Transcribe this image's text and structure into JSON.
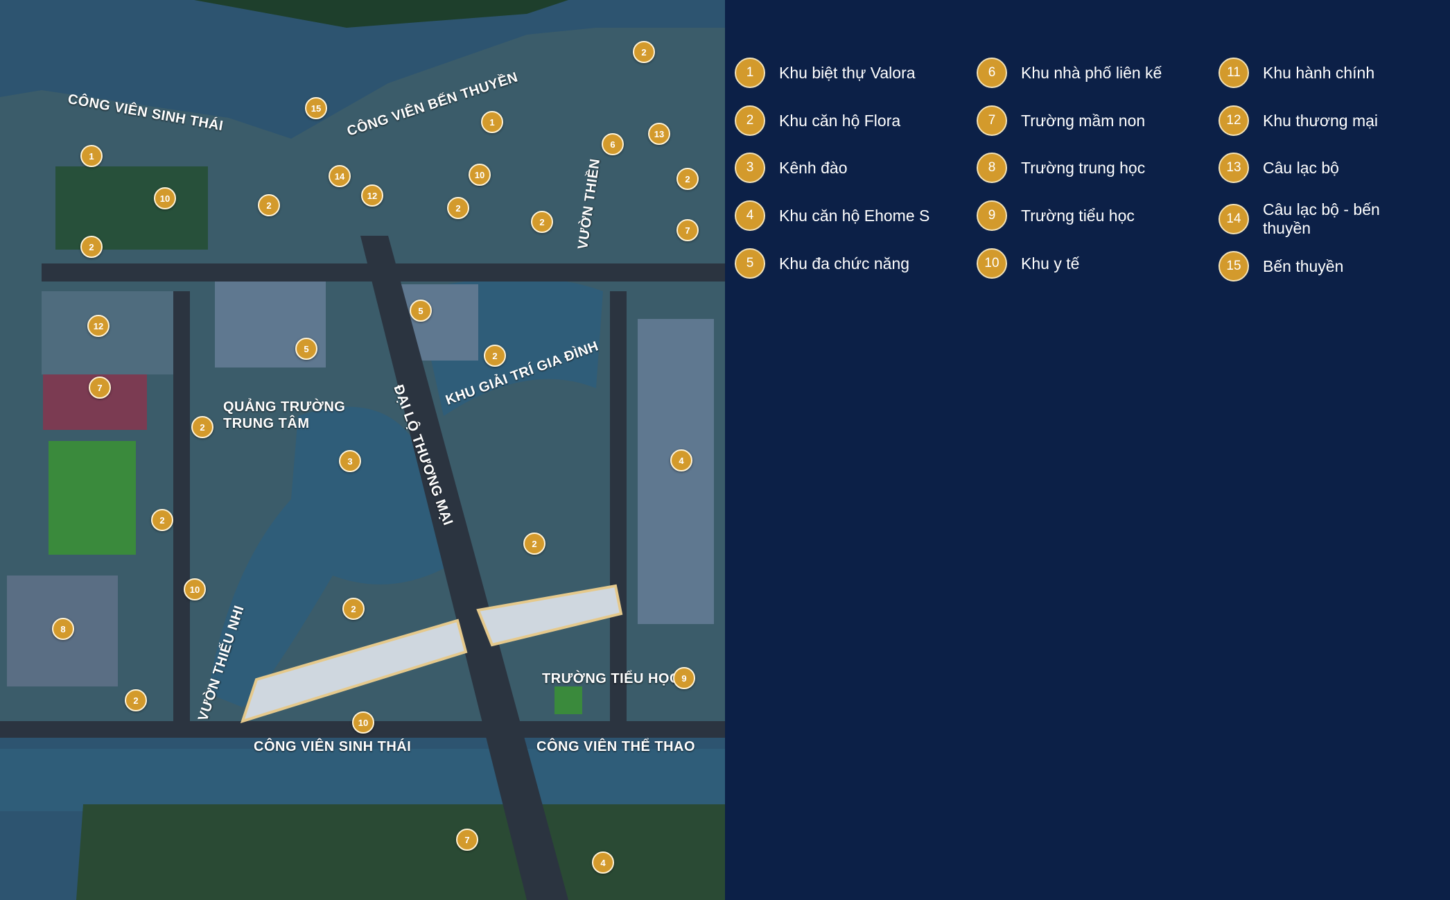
{
  "colors": {
    "background": "#0c2047",
    "marker": "#d39a2c",
    "water": "#2f5d79",
    "greenery": "#1f4a2c"
  },
  "map": {
    "labels": [
      "CÔNG VIÊN SINH THÁI",
      "CÔNG VIÊN BẾN THUYỀN",
      "VƯỜN THIỀN",
      "QUẢNG TRƯỜNG",
      "TRUNG TÂM",
      "ĐẠI LỘ THƯƠNG MẠI",
      "KHU GIẢI TRÍ GIA ĐÌNH",
      "VƯỜN THIẾU NHI",
      "TRƯỜNG TIỂU HỌC",
      "CÔNG VIÊN SINH THÁI",
      "CÔNG VIÊN THỂ THAO"
    ],
    "markers": [
      "2",
      "15",
      "1",
      "1",
      "10",
      "14",
      "12",
      "10",
      "2",
      "2",
      "2",
      "6",
      "13",
      "2",
      "7",
      "2",
      "12",
      "5",
      "5",
      "2",
      "7",
      "2",
      "3",
      "4",
      "2",
      "2",
      "10",
      "2",
      "8",
      "9",
      "2",
      "10",
      "7",
      "4"
    ]
  },
  "legend": {
    "items": [
      {
        "num": "1",
        "label": "Khu biệt thự Valora"
      },
      {
        "num": "2",
        "label": "Khu căn hộ Flora"
      },
      {
        "num": "3",
        "label": "Kênh đào"
      },
      {
        "num": "4",
        "label": "Khu căn hộ Ehome S"
      },
      {
        "num": "5",
        "label": "Khu đa chức năng"
      },
      {
        "num": "6",
        "label": "Khu nhà phố liên kế"
      },
      {
        "num": "7",
        "label": "Trường mầm non"
      },
      {
        "num": "8",
        "label": "Trường trung học"
      },
      {
        "num": "9",
        "label": "Trường tiểu học"
      },
      {
        "num": "10",
        "label": "Khu y tế"
      },
      {
        "num": "11",
        "label": "Khu hành chính"
      },
      {
        "num": "12",
        "label": "Khu thương mại"
      },
      {
        "num": "13",
        "label": "Câu lạc bộ"
      },
      {
        "num": "14",
        "label": "Câu lạc bộ - bến thuyền"
      },
      {
        "num": "15",
        "label": "Bến thuyền"
      }
    ]
  }
}
